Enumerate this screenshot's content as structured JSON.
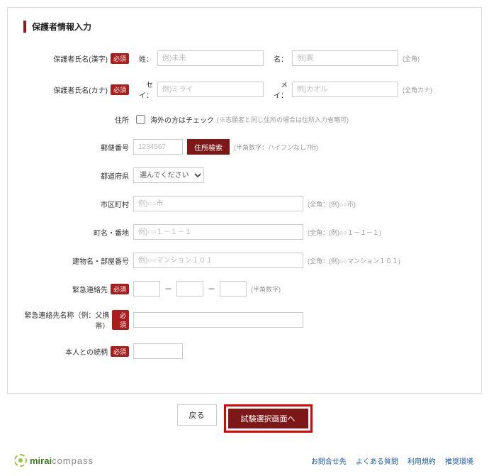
{
  "section_title": "保護者情報入力",
  "required_badge": "必須",
  "rows": {
    "name_kanji": {
      "label": "保護者氏名(漢字)",
      "sei_label": "姓：",
      "mei_label": "名：",
      "sei_ph": "例)未来",
      "mei_ph": "例)翼",
      "hint": "(全角)"
    },
    "name_kana": {
      "label": "保護者氏名(カナ)",
      "sei_label": "セイ：",
      "mei_label": "メイ：",
      "sei_ph": "例)ミライ",
      "mei_ph": "例)カオル",
      "hint": "(全角カナ)"
    },
    "address": {
      "label": "住所",
      "checkbox_label": "海外の方はチェック",
      "checkbox_hint": "(※志願者と同じ住所の場合は住所入力省略可)"
    },
    "zip": {
      "label": "郵便番号",
      "ph": "1234567",
      "btn": "住所検索",
      "hint": "(半角数字：ハイフンなし7桁)"
    },
    "pref": {
      "label": "都道府県",
      "option": "選んでください"
    },
    "city": {
      "label": "市区町村",
      "ph": "例)○○市",
      "hint": "(全角：(例)○○市)"
    },
    "town": {
      "label": "町名・番地",
      "ph": "例)○○１－１－１",
      "hint": "(全角：(例)○○１－１－１)"
    },
    "bldg": {
      "label": "建物名・部屋番号",
      "ph": "例)○○マンション１０１",
      "hint": "(全角：(例)○○マンション１０１)"
    },
    "tel": {
      "label": "緊急連絡先",
      "sep": "－",
      "hint": "(半角数字)"
    },
    "tel_name": {
      "label": "緊急連絡先名称（例：父携帯）"
    },
    "relation": {
      "label": "本人との続柄"
    }
  },
  "buttons": {
    "back": "戻る",
    "next": "試験選択画面へ"
  },
  "logo": {
    "bold": "mirai",
    "rest": "compass"
  },
  "footer_links": [
    "お問合せ先",
    "よくある質問",
    "利用規約",
    "推奨環境"
  ]
}
